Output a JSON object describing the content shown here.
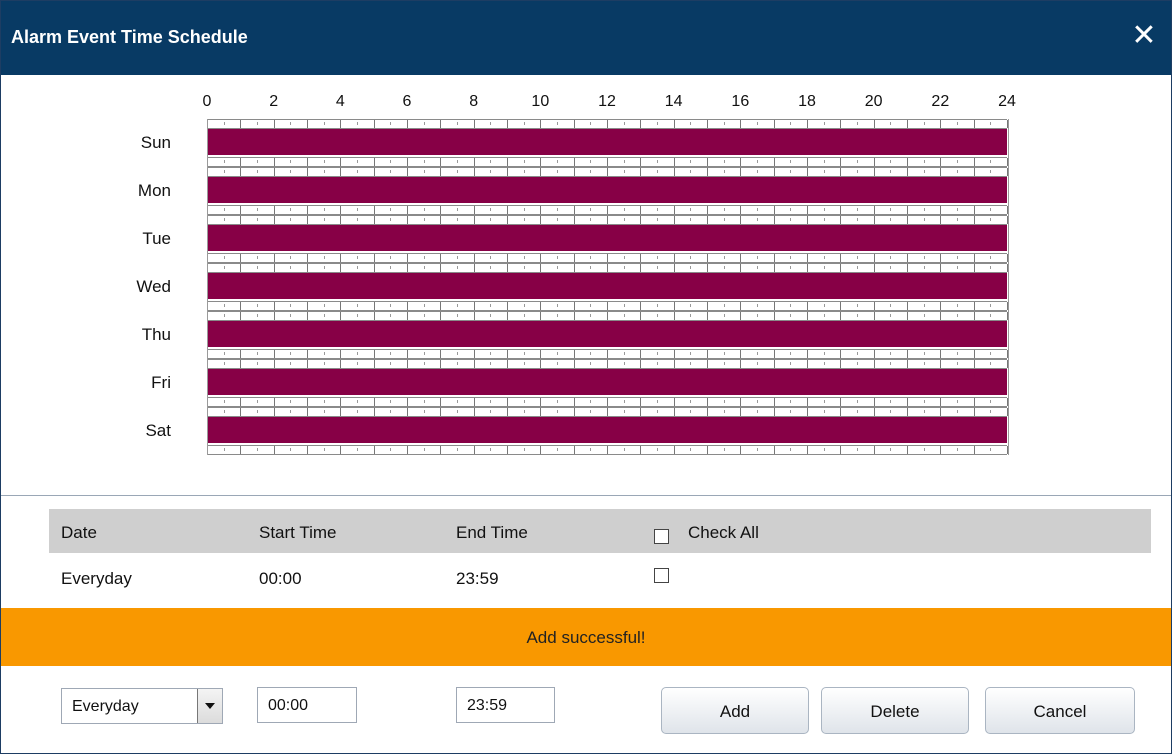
{
  "window": {
    "title": "Alarm Event Time Schedule",
    "close_icon": "close-icon"
  },
  "schedule": {
    "hours": [
      "0",
      "2",
      "4",
      "6",
      "8",
      "10",
      "12",
      "14",
      "16",
      "18",
      "20",
      "22",
      "24"
    ],
    "days": [
      "Sun",
      "Mon",
      "Tue",
      "Wed",
      "Thu",
      "Fri",
      "Sat"
    ],
    "active_color": "#870046",
    "range_start_hour": 0,
    "range_end_hour": 24
  },
  "table": {
    "headers": {
      "date": "Date",
      "start_time": "Start Time",
      "end_time": "End Time",
      "check_all": "Check All"
    },
    "rows": [
      {
        "date": "Everyday",
        "start": "00:00",
        "end": "23:59",
        "checked": false
      }
    ]
  },
  "toast": {
    "text": "Add successful!",
    "color": "#f99800"
  },
  "form": {
    "day_select": "Everyday",
    "start_value": "00:00",
    "end_value": "23:59"
  },
  "buttons": {
    "add": "Add",
    "delete": "Delete",
    "cancel": "Cancel"
  }
}
